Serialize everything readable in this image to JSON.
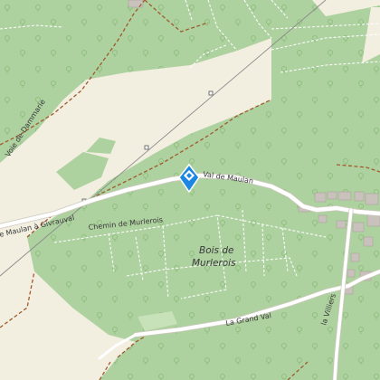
{
  "map": {
    "colors": {
      "forest": "#aed1a0",
      "open_land": "#f2efe1",
      "road": "#ffffff",
      "path": "#a05a2c",
      "building": "#c9c1bb",
      "marker": "#1c86e3"
    },
    "labels": {
      "val_de_maulan": "Val de Maulan",
      "chemin_de_murlerois": "Chemin de Murlerois",
      "bois_de": "Bois de",
      "murlerois": "Murlerois",
      "la_grand_val": "La Grand Val",
      "route_maulan_givrauval": "e Maulan à Givrauval",
      "voie_de_dammarie": "Voie de Dammarie",
      "la_villiers": "la Villiers"
    },
    "marker": {
      "icon": "waypoint-diamond-icon"
    }
  }
}
